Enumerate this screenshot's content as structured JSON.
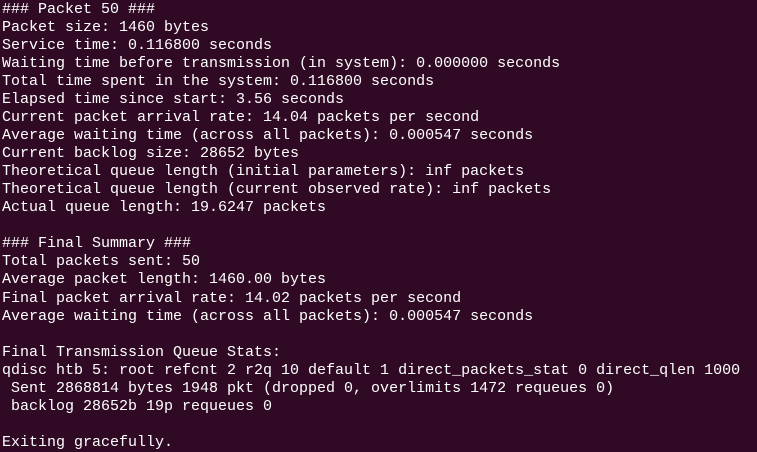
{
  "terminal": {
    "lines": [
      "### Packet 50 ###",
      "Packet size: 1460 bytes",
      "Service time: 0.116800 seconds",
      "Waiting time before transmission (in system): 0.000000 seconds",
      "Total time spent in the system: 0.116800 seconds",
      "Elapsed time since start: 3.56 seconds",
      "Current packet arrival rate: 14.04 packets per second",
      "Average waiting time (across all packets): 0.000547 seconds",
      "Current backlog size: 28652 bytes",
      "Theoretical queue length (initial parameters): inf packets",
      "Theoretical queue length (current observed rate): inf packets",
      "Actual queue length: 19.6247 packets",
      "",
      "### Final Summary ###",
      "Total packets sent: 50",
      "Average packet length: 1460.00 bytes",
      "Final packet arrival rate: 14.02 packets per second",
      "Average waiting time (across all packets): 0.000547 seconds",
      "",
      "Final Transmission Queue Stats:",
      "qdisc htb 5: root refcnt 2 r2q 10 default 1 direct_packets_stat 0 direct_qlen 1000",
      " Sent 2868814 bytes 1948 pkt (dropped 0, overlimits 1472 requeues 0)",
      " backlog 28652b 19p requeues 0",
      "",
      "Exiting gracefully."
    ]
  }
}
